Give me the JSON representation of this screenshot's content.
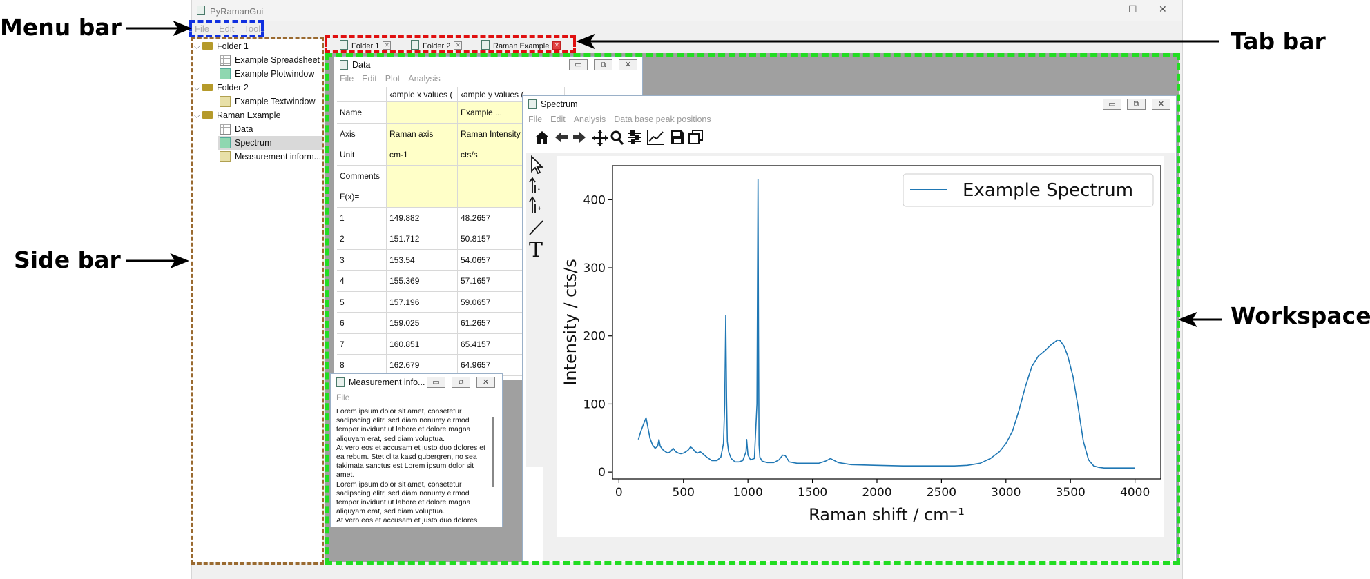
{
  "callouts": {
    "menu_bar": "Menu bar",
    "tab_bar": "Tab bar",
    "side_bar": "Side bar",
    "workspace": "Workspace"
  },
  "app": {
    "title": "PyRamanGui",
    "menu": [
      "File",
      "Edit",
      "Tools"
    ]
  },
  "window_controls": {
    "minimize": "—",
    "maximize": "☐",
    "close": "✕"
  },
  "sidebar": {
    "items": [
      {
        "label": "Folder 1",
        "type": "folder",
        "expanded": true
      },
      {
        "label": "Example Spreadsheet",
        "type": "spreadsheet"
      },
      {
        "label": "Example Plotwindow",
        "type": "plot"
      },
      {
        "label": "Folder 2",
        "type": "folder",
        "expanded": true
      },
      {
        "label": "Example Textwindow",
        "type": "text"
      },
      {
        "label": "Raman Example",
        "type": "folder",
        "expanded": true
      },
      {
        "label": "Data",
        "type": "spreadsheet"
      },
      {
        "label": "Spectrum",
        "type": "plot",
        "selected": true
      },
      {
        "label": "Measurement inform...",
        "type": "text"
      }
    ]
  },
  "tabs": [
    {
      "label": "Folder 1",
      "close": "✕"
    },
    {
      "label": "Folder 2",
      "close": "✕"
    },
    {
      "label": "Raman Example",
      "close": "✕",
      "active": true
    }
  ],
  "data_window": {
    "title": "Data",
    "menu": [
      "File",
      "Edit",
      "Plot",
      "Analysis"
    ],
    "col_headers": [
      "‹ample x values (",
      "‹ample y values ("
    ],
    "meta_rows": [
      {
        "label": "Name",
        "x": "",
        "y": "Example ..."
      },
      {
        "label": "Axis",
        "x": "Raman axis",
        "y": "Raman Intensity"
      },
      {
        "label": "Unit",
        "x": "cm-1",
        "y": "cts/s"
      },
      {
        "label": "Comments",
        "x": "",
        "y": ""
      },
      {
        "label": "F(x)=",
        "x": "",
        "y": ""
      }
    ],
    "rows": [
      {
        "n": "1",
        "x": "149.882",
        "y": "48.2657"
      },
      {
        "n": "2",
        "x": "151.712",
        "y": "50.8157"
      },
      {
        "n": "3",
        "x": "153.54",
        "y": "54.0657"
      },
      {
        "n": "4",
        "x": "155.369",
        "y": "57.1657"
      },
      {
        "n": "5",
        "x": "157.196",
        "y": "59.0657"
      },
      {
        "n": "6",
        "x": "159.025",
        "y": "61.2657"
      },
      {
        "n": "7",
        "x": "160.851",
        "y": "65.4157"
      },
      {
        "n": "8",
        "x": "162.679",
        "y": "64.9657"
      }
    ]
  },
  "measurement_window": {
    "title": "Measurement info...",
    "menu": [
      "File"
    ],
    "text": "Lorem ipsum dolor sit amet, consetetur sadipscing elitr, sed diam nonumy eirmod tempor invidunt ut labore et dolore magna aliquyam erat, sed diam voluptua.\nAt vero eos et accusam et justo duo dolores et ea rebum. Stet clita kasd gubergren, no sea takimata sanctus est Lorem ipsum dolor sit amet.\nLorem ipsum dolor sit amet, consetetur sadipscing elitr, sed diam nonumy eirmod tempor invidunt ut labore et dolore magna aliquyam erat, sed diam voluptua.\nAt vero eos et accusam et justo duo dolores"
  },
  "spectrum_window": {
    "title": "Spectrum",
    "menu": [
      "File",
      "Edit",
      "Analysis",
      "Data base peak positions"
    ],
    "toolbar_icons": [
      "home-icon",
      "back-icon",
      "forward-icon",
      "pan-icon",
      "zoom-icon",
      "configure-icon",
      "axes-edit-icon",
      "save-icon",
      "copy-icon"
    ],
    "side_tools": [
      "pointer-icon",
      "peak-arrow-1-icon",
      "peak-arrow-2-icon",
      "line-icon",
      "text-icon"
    ]
  },
  "chart_data": {
    "type": "line",
    "xlabel": "Raman shift / cm⁻¹",
    "ylabel": "Intensity / cts/s",
    "xlim": [
      -50,
      4200
    ],
    "ylim": [
      -10,
      450
    ],
    "xticks": [
      0,
      500,
      1000,
      1500,
      2000,
      2500,
      3000,
      3500,
      4000
    ],
    "yticks": [
      0,
      100,
      200,
      300,
      400
    ],
    "legend": "top-right",
    "grid": false,
    "line_color": "#1f77b4",
    "series": [
      {
        "name": "Example Spectrum",
        "x": [
          150,
          170,
          190,
          210,
          225,
          240,
          260,
          280,
          300,
          310,
          320,
          340,
          360,
          380,
          400,
          420,
          440,
          460,
          480,
          500,
          520,
          540,
          555,
          570,
          590,
          610,
          630,
          650,
          680,
          720,
          760,
          790,
          810,
          820,
          828,
          834,
          840,
          850,
          870,
          900,
          930,
          960,
          985,
          990,
          1000,
          1020,
          1050,
          1070,
          1078,
          1082,
          1086,
          1092,
          1110,
          1150,
          1200,
          1240,
          1270,
          1290,
          1320,
          1380,
          1450,
          1550,
          1600,
          1640,
          1660,
          1700,
          1800,
          2000,
          2200,
          2400,
          2600,
          2700,
          2800,
          2880,
          2950,
          3000,
          3050,
          3100,
          3150,
          3200,
          3250,
          3300,
          3350,
          3400,
          3420,
          3450,
          3480,
          3520,
          3560,
          3600,
          3640,
          3680,
          3720,
          3760,
          3800,
          3900,
          4000
        ],
        "y": [
          48,
          60,
          70,
          80,
          65,
          50,
          40,
          35,
          38,
          48,
          38,
          33,
          30,
          28,
          30,
          35,
          30,
          28,
          27,
          28,
          30,
          33,
          37,
          35,
          30,
          28,
          30,
          27,
          22,
          17,
          17,
          22,
          42,
          100,
          230,
          110,
          45,
          30,
          20,
          15,
          15,
          17,
          30,
          48,
          25,
          18,
          20,
          100,
          430,
          200,
          40,
          22,
          16,
          14,
          14,
          18,
          25,
          24,
          15,
          13,
          13,
          13,
          16,
          20,
          18,
          14,
          11,
          10,
          9,
          9,
          9,
          10,
          13,
          20,
          30,
          42,
          60,
          90,
          125,
          155,
          170,
          178,
          187,
          194,
          193,
          185,
          170,
          140,
          95,
          45,
          18,
          9,
          7,
          6,
          6,
          6,
          6
        ]
      }
    ]
  }
}
